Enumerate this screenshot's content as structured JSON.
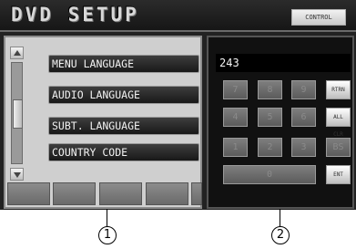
{
  "header": {
    "title": "DVD SETUP",
    "control_label": "CONTROL"
  },
  "menu": {
    "items": [
      {
        "label": "MENU LANGUAGE"
      },
      {
        "label": "AUDIO LANGUAGE"
      },
      {
        "label": "SUBT. LANGUAGE"
      },
      {
        "label": "COUNTRY CODE"
      }
    ]
  },
  "keypad": {
    "display_value": "243",
    "keys": [
      [
        "7",
        "8",
        "9",
        "RTRN"
      ],
      [
        "4",
        "5",
        "6",
        "ALL CLR"
      ],
      [
        "1",
        "2",
        "3",
        "BS"
      ],
      [
        "0",
        "ENT"
      ]
    ]
  },
  "callouts": [
    "1",
    "2"
  ]
}
